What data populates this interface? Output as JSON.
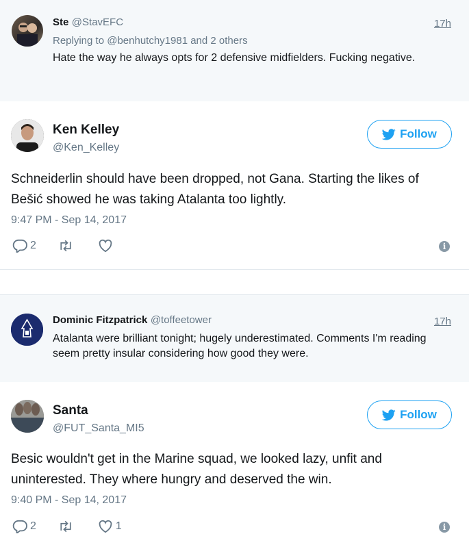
{
  "tweets": [
    {
      "type": "context",
      "name": "Ste",
      "handle": "@StavEFC",
      "time": "17h",
      "replying_prefix": "Replying to",
      "replying_to": "@benhutchy1981",
      "replying_suffix": "and 2 others",
      "text": "Hate the way he always opts for 2 defensive midfielders. Fucking negative."
    },
    {
      "type": "main",
      "name": "Ken Kelley",
      "handle": "@Ken_Kelley",
      "follow_label": "Follow",
      "text": "Schneiderlin should have been dropped, not Gana. Starting the likes of Bešić showed he was taking Atalanta too lightly.",
      "date": "9:47 PM - Sep 14, 2017",
      "replies": "2",
      "retweets": "",
      "likes": ""
    },
    {
      "type": "context",
      "name": "Dominic Fitzpatrick",
      "handle": "@toffeetower",
      "time": "17h",
      "text": "Atalanta were brilliant tonight; hugely underestimated. Comments I'm reading seem pretty insular considering how good they were."
    },
    {
      "type": "main",
      "name": "Santa",
      "handle": "@FUT_Santa_MI5",
      "follow_label": "Follow",
      "text": "Besic wouldn't get in the Marine squad, we looked lazy, unfit and uninterested. They where hungry and deserved the win.",
      "date": "9:40 PM - Sep 14, 2017",
      "replies": "2",
      "retweets": "",
      "likes": "1"
    }
  ],
  "colors": {
    "accent": "#1da1f2",
    "muted": "#657786",
    "context_bg": "#f5f8fa",
    "text": "#14171a"
  }
}
